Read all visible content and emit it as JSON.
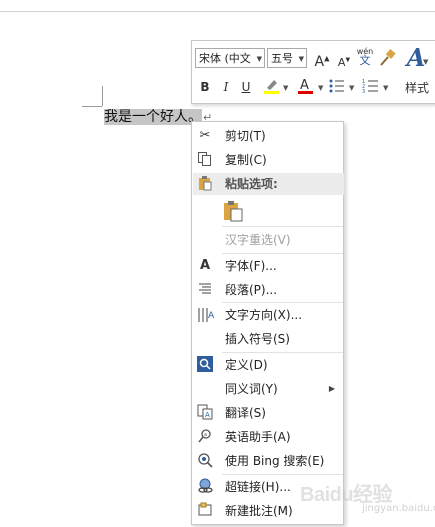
{
  "document": {
    "text": "我是一个好人。",
    "paragraph_mark": "↵"
  },
  "mini_toolbar": {
    "font_name": "宋体 (中文",
    "font_size": "五号",
    "styles_label": "样式",
    "pinyin_glyph": "wén",
    "pinyin_char": "文"
  },
  "context_menu": {
    "cut": "剪切(T)",
    "copy": "复制(C)",
    "paste_options": "粘贴选项:",
    "reconvert": "汉字重选(V)",
    "font": "字体(F)...",
    "paragraph": "段落(P)...",
    "text_direction": "文字方向(X)...",
    "insert_symbol": "插入符号(S)",
    "define": "定义(D)",
    "synonyms": "同义词(Y)",
    "translate": "翻译(S)",
    "english_assistant": "英语助手(A)",
    "bing_search": "使用 Bing 搜索(E)",
    "hyperlink": "超链接(H)...",
    "new_comment": "新建批注(M)"
  },
  "watermark": {
    "logo": "Baidu经验",
    "url": "jingyan.baidu.com"
  },
  "colors": {
    "highlight": "#ffff00",
    "font_color": "#e00000",
    "selection": "#c6c6c6",
    "accent": "#2f5d9e"
  }
}
